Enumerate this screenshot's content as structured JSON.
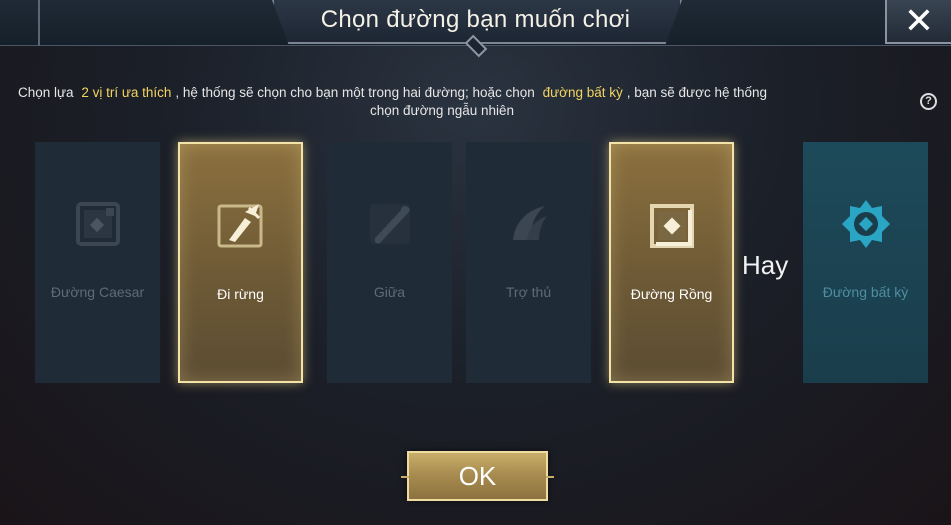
{
  "dialog": {
    "title": "Chọn đường bạn muốn chơi",
    "close_label": "✕"
  },
  "description": {
    "part1": "Chọn lựa",
    "highlight1": "2 vị trí ưa thích",
    "part2": ", hệ thống sẽ chọn cho bạn một trong hai đường; hoặc chọn",
    "highlight2": "đường bất kỳ",
    "part3": ", bạn sẽ được hệ thống",
    "line2": "chọn đường ngẫu nhiên",
    "help_label": "?"
  },
  "cards": [
    {
      "label": "Đường Caesar",
      "icon": "caesar-lane-icon",
      "selected": false
    },
    {
      "label": "Đi rừng",
      "icon": "jungle-icon",
      "selected": true
    },
    {
      "label": "Giữa",
      "icon": "mid-lane-icon",
      "selected": false
    },
    {
      "label": "Trợ thủ",
      "icon": "support-icon",
      "selected": false
    },
    {
      "label": "Đường Rồng",
      "icon": "dragon-lane-icon",
      "selected": true
    },
    {
      "label": "Đường bất kỳ",
      "icon": "any-lane-icon",
      "selected": false
    }
  ],
  "separator": "Hay",
  "ok_label": "OK",
  "colors": {
    "highlight": "#f2d460",
    "selected_border": "#f4e3a8",
    "selected_fill": "#8c713f",
    "any_fill": "#1d4a5a"
  }
}
